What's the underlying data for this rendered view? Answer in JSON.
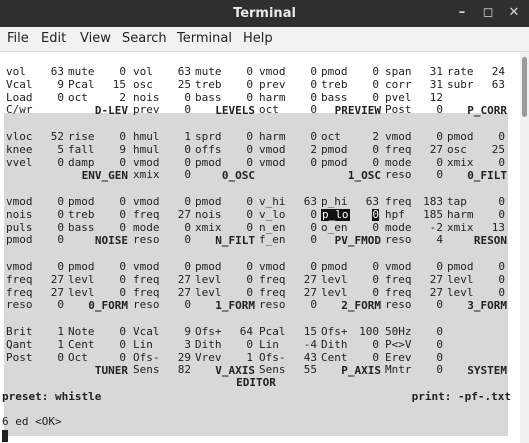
{
  "window": {
    "title": "Terminal",
    "min_glyph": "–",
    "max_glyph": "◻",
    "close_glyph": "✕"
  },
  "menu": [
    "File",
    "Edit",
    "View",
    "Search",
    "Terminal",
    "Help"
  ],
  "groups": [
    {
      "name": "D-LEV",
      "rows": [
        [
          [
            "vol",
            "63"
          ],
          [
            "mute",
            "0"
          ]
        ],
        [
          [
            "Vcal",
            "9"
          ],
          [
            "Pcal",
            "15"
          ]
        ],
        [
          [
            "Load",
            "0"
          ],
          [
            "oct",
            "2"
          ]
        ],
        [
          [
            "C/wr",
            ""
          ],
          [
            "",
            ""
          ]
        ]
      ]
    },
    {
      "name": "LEVELS",
      "rows": [
        [
          [
            "vol",
            "63"
          ],
          [
            "mute",
            "0"
          ]
        ],
        [
          [
            "osc",
            "25"
          ],
          [
            "treb",
            "0"
          ]
        ],
        [
          [
            "nois",
            "0"
          ],
          [
            "bass",
            "0"
          ]
        ],
        [
          [
            "prev",
            "0"
          ],
          [
            "",
            ""
          ]
        ]
      ]
    },
    {
      "name": "PREVIEW",
      "rows": [
        [
          [
            "vmod",
            "0"
          ],
          [
            "pmod",
            "0"
          ]
        ],
        [
          [
            "prev",
            "0"
          ],
          [
            "treb",
            "0"
          ]
        ],
        [
          [
            "harm",
            "0"
          ],
          [
            "bass",
            "0"
          ]
        ],
        [
          [
            "oct",
            "0"
          ],
          [
            "",
            ""
          ]
        ]
      ]
    },
    {
      "name": "P_CORR",
      "rows": [
        [
          [
            "span",
            "31"
          ],
          [
            "rate",
            "24"
          ]
        ],
        [
          [
            "corr",
            "31"
          ],
          [
            "subr",
            "63"
          ]
        ],
        [
          [
            "pvel",
            "12"
          ],
          [
            "",
            ""
          ]
        ],
        [
          [
            "Post",
            "0"
          ],
          [
            "",
            ""
          ]
        ]
      ]
    },
    {
      "name": "ENV_GEN",
      "rows": [
        [
          [
            "vloc",
            "52"
          ],
          [
            "rise",
            "0"
          ]
        ],
        [
          [
            "knee",
            "5"
          ],
          [
            "fall",
            "9"
          ]
        ],
        [
          [
            "vvel",
            "0"
          ],
          [
            "damp",
            "0"
          ]
        ]
      ]
    },
    {
      "name": "0_OSC",
      "rows": [
        [
          [
            "hmul",
            "1"
          ],
          [
            "sprd",
            "0"
          ]
        ],
        [
          [
            "hmul",
            "0"
          ],
          [
            "offs",
            "0"
          ]
        ],
        [
          [
            "vmod",
            "0"
          ],
          [
            "pmod",
            "0"
          ]
        ],
        [
          [
            "xmix",
            "0"
          ],
          [
            "",
            ""
          ]
        ]
      ]
    },
    {
      "name": "1_OSC",
      "rows": [
        [
          [
            "harm",
            "0"
          ],
          [
            "oct",
            "2"
          ]
        ],
        [
          [
            "vmod",
            "2"
          ],
          [
            "pmod",
            "0"
          ]
        ],
        [
          [
            "vmod",
            "0"
          ],
          [
            "pmod",
            "0"
          ]
        ]
      ]
    },
    {
      "name": "0_FILT",
      "rows": [
        [
          [
            "vmod",
            "0"
          ],
          [
            "pmod",
            "0"
          ]
        ],
        [
          [
            "freq",
            "27"
          ],
          [
            "osc",
            "25"
          ]
        ],
        [
          [
            "mode",
            "0"
          ],
          [
            "xmix",
            "0"
          ]
        ],
        [
          [
            "reso",
            "0"
          ],
          [
            "",
            ""
          ]
        ]
      ]
    },
    {
      "name": "NOISE",
      "rows": [
        [
          [
            "vmod",
            "0"
          ],
          [
            "pmod",
            "0"
          ]
        ],
        [
          [
            "nois",
            "0"
          ],
          [
            "treb",
            "0"
          ]
        ],
        [
          [
            "puls",
            "0"
          ],
          [
            "bass",
            "0"
          ]
        ],
        [
          [
            "pmod",
            "0"
          ],
          [
            "",
            ""
          ]
        ]
      ]
    },
    {
      "name": "N_FILT",
      "rows": [
        [
          [
            "vmod",
            "0"
          ],
          [
            "pmod",
            "0"
          ]
        ],
        [
          [
            "freq",
            "27"
          ],
          [
            "nois",
            "0"
          ]
        ],
        [
          [
            "mode",
            "0"
          ],
          [
            "xmix",
            "0"
          ]
        ],
        [
          [
            "reso",
            "0"
          ],
          [
            "",
            ""
          ]
        ]
      ]
    },
    {
      "name": "PV_FMOD",
      "rows": [
        [
          [
            "v_hi",
            "63"
          ],
          [
            "p_hi",
            "63"
          ]
        ],
        [
          [
            "v_lo",
            "0"
          ],
          [
            "p_lo",
            "0"
          ]
        ],
        [
          [
            "n_en",
            "0"
          ],
          [
            "o_en",
            "0"
          ]
        ],
        [
          [
            "f_en",
            "0"
          ],
          [
            "",
            ""
          ]
        ]
      ]
    },
    {
      "name": "RESON",
      "rows": [
        [
          [
            "freq",
            "183"
          ],
          [
            "tap",
            "0"
          ]
        ],
        [
          [
            "hpf",
            "185"
          ],
          [
            "harm",
            "0"
          ]
        ],
        [
          [
            "mode",
            "-2"
          ],
          [
            "xmix",
            "13"
          ]
        ],
        [
          [
            "reso",
            "4"
          ],
          [
            "",
            ""
          ]
        ]
      ]
    },
    {
      "name": "0_FORM",
      "rows": [
        [
          [
            "vmod",
            "0"
          ],
          [
            "pmod",
            "0"
          ]
        ],
        [
          [
            "freq",
            "27"
          ],
          [
            "levl",
            "0"
          ]
        ],
        [
          [
            "freq",
            "27"
          ],
          [
            "levl",
            "0"
          ]
        ],
        [
          [
            "reso",
            "0"
          ],
          [
            "",
            ""
          ]
        ]
      ]
    },
    {
      "name": "1_FORM",
      "rows": [
        [
          [
            "vmod",
            "0"
          ],
          [
            "pmod",
            "0"
          ]
        ],
        [
          [
            "freq",
            "27"
          ],
          [
            "levl",
            "0"
          ]
        ],
        [
          [
            "freq",
            "27"
          ],
          [
            "levl",
            "0"
          ]
        ],
        [
          [
            "reso",
            "0"
          ],
          [
            "",
            ""
          ]
        ]
      ]
    },
    {
      "name": "2_FORM",
      "rows": [
        [
          [
            "vmod",
            "0"
          ],
          [
            "pmod",
            "0"
          ]
        ],
        [
          [
            "freq",
            "27"
          ],
          [
            "levl",
            "0"
          ]
        ],
        [
          [
            "freq",
            "27"
          ],
          [
            "levl",
            "0"
          ]
        ],
        [
          [
            "reso",
            "0"
          ],
          [
            "",
            ""
          ]
        ]
      ]
    },
    {
      "name": "3_FORM",
      "rows": [
        [
          [
            "vmod",
            "0"
          ],
          [
            "pmod",
            "0"
          ]
        ],
        [
          [
            "freq",
            "27"
          ],
          [
            "levl",
            "0"
          ]
        ],
        [
          [
            "freq",
            "27"
          ],
          [
            "levl",
            "0"
          ]
        ],
        [
          [
            "reso",
            "0"
          ],
          [
            "",
            ""
          ]
        ]
      ]
    },
    {
      "name": "TUNER",
      "rows": [
        [
          [
            "Brit",
            "1"
          ],
          [
            "Note",
            "0"
          ]
        ],
        [
          [
            "Qant",
            "1"
          ],
          [
            "Cent",
            "0"
          ]
        ],
        [
          [
            "Post",
            "0"
          ],
          [
            "Oct",
            "0"
          ]
        ]
      ]
    },
    {
      "name": "V_AXIS",
      "rows": [
        [
          [
            "Vcal",
            "9"
          ],
          [
            "Ofs+",
            "64"
          ]
        ],
        [
          [
            "Lin",
            "3"
          ],
          [
            "Dith",
            "0"
          ]
        ],
        [
          [
            "Ofs-",
            "29"
          ],
          [
            "Vrev",
            "1"
          ]
        ],
        [
          [
            "Sens",
            "82"
          ],
          [
            "",
            ""
          ]
        ]
      ]
    },
    {
      "name": "P_AXIS",
      "rows": [
        [
          [
            "Pcal",
            "15"
          ],
          [
            "Ofs+",
            "100"
          ]
        ],
        [
          [
            "Lin",
            "-4"
          ],
          [
            "Dith",
            "0"
          ]
        ],
        [
          [
            "Ofs-",
            "43"
          ],
          [
            "Cent",
            "0"
          ]
        ],
        [
          [
            "Sens",
            "55"
          ],
          [
            "",
            ""
          ]
        ]
      ]
    },
    {
      "name": "SYSTEM",
      "rows": [
        [
          [
            "50Hz",
            "0"
          ],
          [
            "",
            ""
          ]
        ],
        [
          [
            "P<>V",
            "0"
          ],
          [
            "",
            ""
          ]
        ],
        [
          [
            "Erev",
            "0"
          ],
          [
            "",
            ""
          ]
        ],
        [
          [
            "Mntr",
            "0"
          ],
          [
            "",
            ""
          ]
        ]
      ]
    }
  ],
  "editor_title": "EDITOR",
  "status": {
    "preset": "preset: whistle",
    "print": "print: -pf-.txt"
  },
  "command_line": "6 ed <OK>"
}
